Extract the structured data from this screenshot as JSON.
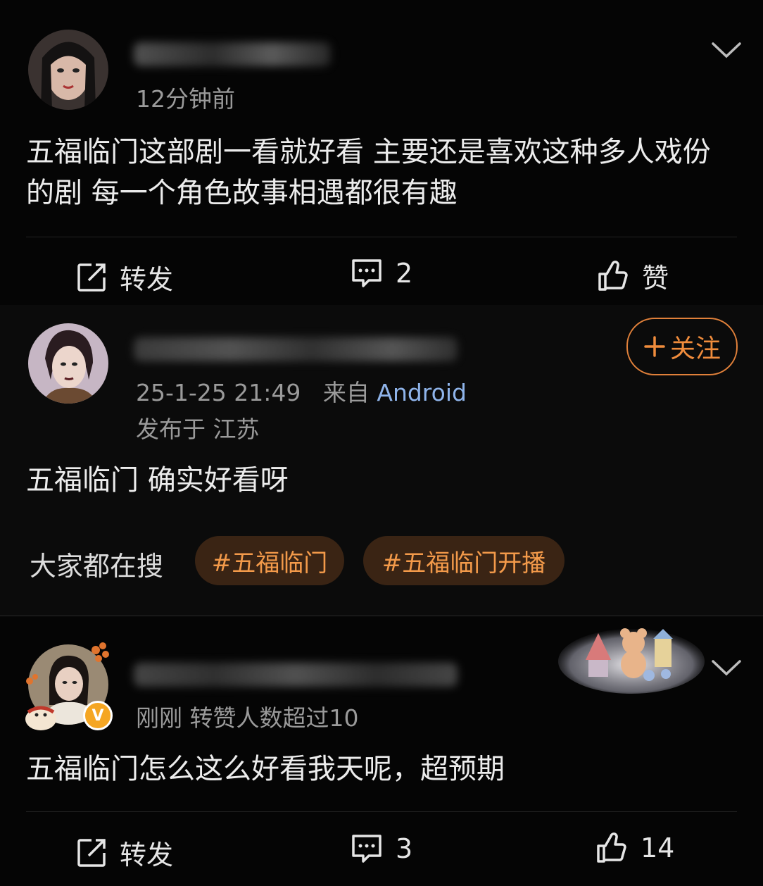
{
  "posts": [
    {
      "time": "12分钟前",
      "content": "五福临门这部剧一看就好看 主要还是喜欢这种多人戏份的剧  每一个角色故事相遇都很有趣",
      "actions": {
        "repost": "转发",
        "comment": "2",
        "like": "赞"
      }
    },
    {
      "date": "25-1-25 21:49",
      "source_prefix": "来自",
      "source": "Android",
      "location": "发布于 江苏",
      "follow": "关注",
      "content": "五福临门 确实好看呀",
      "search_label": "大家都在搜",
      "tags": [
        "#五福临门",
        "#五福临门开播"
      ]
    },
    {
      "meta": "刚刚 转赞人数超过10",
      "content": "五福临门怎么这么好看我天呢，超预期",
      "actions": {
        "repost": "转发",
        "comment": "3",
        "like": "14"
      }
    }
  ],
  "icons": {
    "repost": "repost-icon",
    "comment": "comment-icon",
    "like": "thumbs-up-icon",
    "more": "chevron-down-icon",
    "verified": "verified-v-icon"
  },
  "colors": {
    "accent": "#f08c3c",
    "link": "#8fb4ea"
  }
}
